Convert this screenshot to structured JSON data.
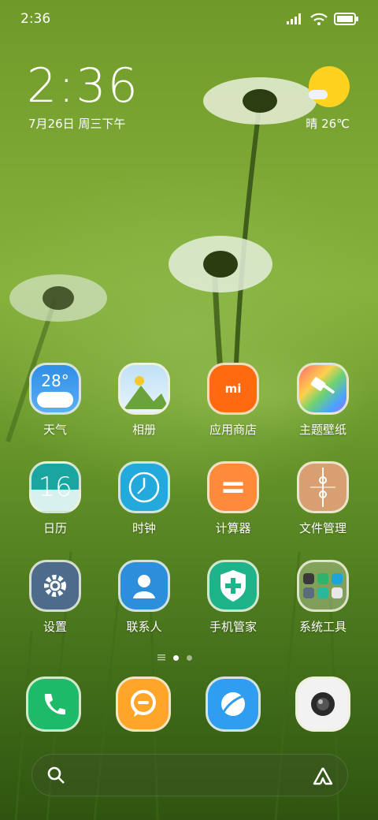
{
  "status_bar": {
    "time": "2:36"
  },
  "clock_widget": {
    "time": "2:36",
    "date": "7月26日 周三下午",
    "weather": "晴 26℃"
  },
  "apps": [
    {
      "name": "天气",
      "icon": "weather-icon",
      "text": "28°"
    },
    {
      "name": "相册",
      "icon": "gallery-icon"
    },
    {
      "name": "应用商店",
      "icon": "app-store-icon",
      "text": "mi"
    },
    {
      "name": "主题壁纸",
      "icon": "themes-icon"
    },
    {
      "name": "日历",
      "icon": "calendar-icon",
      "text": "16"
    },
    {
      "name": "时钟",
      "icon": "clock-icon"
    },
    {
      "name": "计算器",
      "icon": "calculator-icon",
      "text": "="
    },
    {
      "name": "文件管理",
      "icon": "file-manager-icon"
    },
    {
      "name": "设置",
      "icon": "settings-icon"
    },
    {
      "name": "联系人",
      "icon": "contacts-icon"
    },
    {
      "name": "手机管家",
      "icon": "security-icon"
    },
    {
      "name": "系统工具",
      "icon": "folder-icon"
    }
  ],
  "dock": [
    {
      "icon": "phone-icon"
    },
    {
      "icon": "messages-icon"
    },
    {
      "icon": "browser-icon"
    },
    {
      "icon": "camera-icon"
    }
  ],
  "colors": {
    "weather": "#2f8ee6",
    "app_store": "#ff6a10",
    "calendar": "#1aa5a0",
    "clock": "#23a9db",
    "calculator": "#ff8a3c",
    "file_manager": "#d8a070",
    "settings": "#4d6b8a",
    "contacts": "#2d8fdc",
    "security": "#1fb38a",
    "phone": "#1dba6a",
    "messages": "#ffa52a",
    "browser": "#2f9df0",
    "camera": "#f2f2f2"
  }
}
